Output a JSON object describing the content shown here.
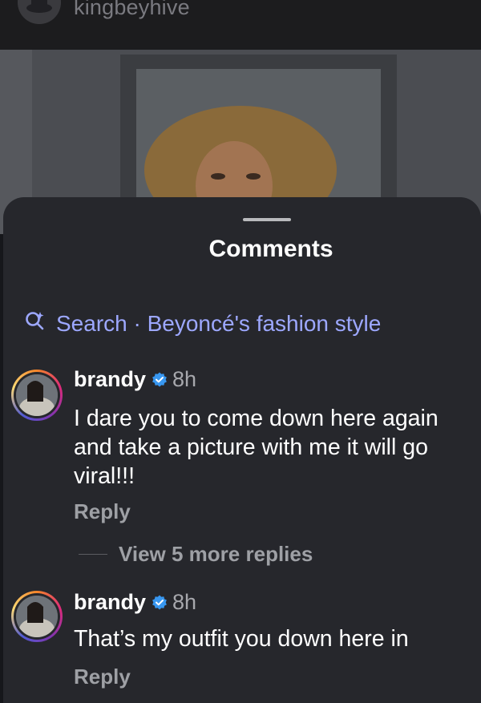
{
  "header": {
    "username": "kingbeyhive"
  },
  "comments_sheet": {
    "title": "Comments",
    "search_label": "Search · Beyoncé's fashion style"
  },
  "comments": [
    {
      "username": "brandy",
      "time": "8h",
      "text": "I dare you to come down here again and take a picture with me it will go viral!!!",
      "reply_label": "Reply",
      "view_replies_label": "View 5 more replies"
    },
    {
      "username": "brandy",
      "time": "8h",
      "text": "That’s my outfit you down here in",
      "reply_label": "Reply"
    }
  ],
  "colors": {
    "accent_search": "#9da8ff",
    "verified_badge": "#3897f0",
    "sheet_background": "#26272c"
  },
  "icons": [
    "avatar",
    "search-sparkle-icon",
    "verified-badge-icon"
  ]
}
